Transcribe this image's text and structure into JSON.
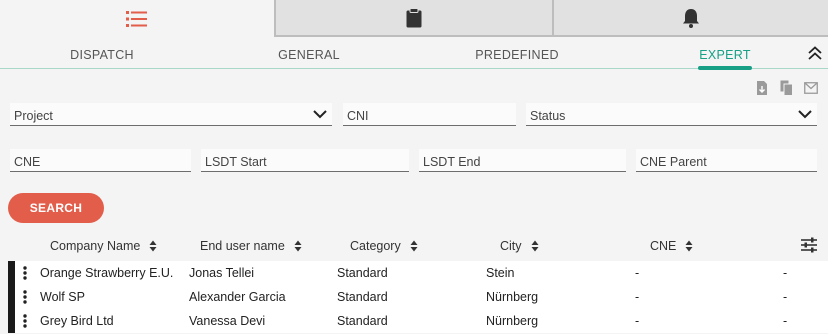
{
  "icon_tabs": [
    {
      "icon": "list-icon",
      "color": "#e35d4b",
      "active": true
    },
    {
      "icon": "clipboard-icon",
      "color": "#333333",
      "active": false
    },
    {
      "icon": "bell-icon",
      "color": "#333333",
      "active": false
    }
  ],
  "tabs": {
    "dispatch": "DISPATCH",
    "general": "GENERAL",
    "predefined": "PREDEFINED",
    "expert": "EXPERT",
    "active": "EXPERT"
  },
  "actions": {
    "export_icon": "file-download-icon",
    "copy_icon": "copy-icon",
    "mail_icon": "mail-icon"
  },
  "filters": {
    "project": {
      "placeholder": "Project",
      "value": ""
    },
    "cni": {
      "placeholder": "CNI",
      "value": ""
    },
    "status": {
      "placeholder": "Status",
      "value": ""
    },
    "cne": {
      "placeholder": "CNE",
      "value": ""
    },
    "lsdt_start": {
      "placeholder": "LSDT Start",
      "value": ""
    },
    "lsdt_end": {
      "placeholder": "LSDT End",
      "value": ""
    },
    "cne_parent": {
      "placeholder": "CNE Parent",
      "value": ""
    }
  },
  "search_label": "SEARCH",
  "table": {
    "columns": [
      "Company Name",
      "End user name",
      "Category",
      "City",
      "CNE"
    ],
    "rows": [
      {
        "company": "Orange Strawberry E.U.",
        "end_user": "Jonas Tellei",
        "category": "Standard",
        "city": "Stein",
        "cne": "-",
        "extra": "-"
      },
      {
        "company": "Wolf SP",
        "end_user": "Alexander Garcia",
        "category": "Standard",
        "city": "Nürnberg",
        "cne": "-",
        "extra": "-"
      },
      {
        "company": "Grey Bird Ltd",
        "end_user": "Vanessa Devi",
        "category": "Standard",
        "city": "Nürnberg",
        "cne": "-",
        "extra": "-"
      }
    ]
  },
  "colors": {
    "accent": "#17a085",
    "primary": "#e35d4b",
    "row_marker": "#1a1a1a"
  }
}
